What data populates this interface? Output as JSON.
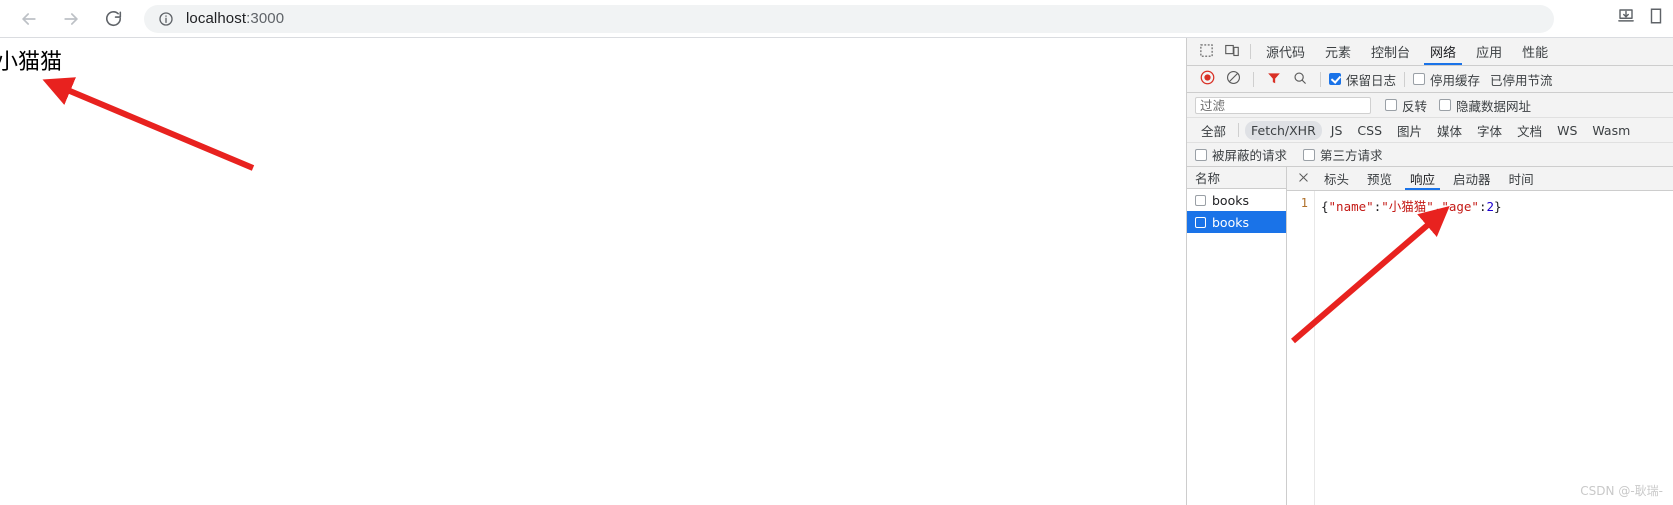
{
  "browser": {
    "back_label": "back-arrow",
    "forward_label": "forward-arrow",
    "reload_label": "reload",
    "info_label": "site-info",
    "url_prefix": "localhost",
    "url_suffix": ":3000",
    "download_label": "downloads",
    "profile_label": "profile"
  },
  "page": {
    "heading": "小猫猫"
  },
  "devtools": {
    "inspect_icon": "inspect-element-icon",
    "device_icon": "device-toolbar-icon",
    "tabs": [
      {
        "label": "源代码",
        "active": false
      },
      {
        "label": "元素",
        "active": false
      },
      {
        "label": "控制台",
        "active": false
      },
      {
        "label": "网络",
        "active": true
      },
      {
        "label": "应用",
        "active": false
      },
      {
        "label": "性能",
        "active": false
      }
    ],
    "actionbar": {
      "record_icon": "record-stop-icon",
      "clear_icon": "clear-icon",
      "filter_icon": "filter-icon",
      "search_icon": "search-icon",
      "preserve_log": {
        "label": "保留日志",
        "checked": true
      },
      "disable_cache": {
        "label": "停用缓存",
        "checked": false
      },
      "throttling": "已停用节流"
    },
    "filterbar": {
      "placeholder": "过滤",
      "value": "",
      "invert": {
        "label": "反转",
        "checked": false
      },
      "hide_data_urls": {
        "label": "隐藏数据网址",
        "checked": false
      }
    },
    "types": [
      {
        "label": "全部",
        "selected": false
      },
      {
        "label": "Fetch/XHR",
        "selected": true
      },
      {
        "label": "JS",
        "selected": false
      },
      {
        "label": "CSS",
        "selected": false
      },
      {
        "label": "图片",
        "selected": false
      },
      {
        "label": "媒体",
        "selected": false
      },
      {
        "label": "字体",
        "selected": false
      },
      {
        "label": "文档",
        "selected": false
      },
      {
        "label": "WS",
        "selected": false
      },
      {
        "label": "Wasm",
        "selected": false
      }
    ],
    "extra_filters": [
      {
        "label": "被屏蔽的请求",
        "checked": false
      },
      {
        "label": "第三方请求",
        "checked": false
      }
    ],
    "request_list": {
      "column_header": "名称",
      "rows": [
        {
          "name": "books",
          "selected": false,
          "checked": false
        },
        {
          "name": "books",
          "selected": true,
          "checked": false
        }
      ]
    },
    "detail": {
      "close_icon": "close-icon",
      "tabs": [
        {
          "label": "标头",
          "active": false
        },
        {
          "label": "预览",
          "active": false
        },
        {
          "label": "响应",
          "active": true
        },
        {
          "label": "启动器",
          "active": false
        },
        {
          "label": "时间",
          "active": false
        }
      ],
      "line_number": "1",
      "response": {
        "brace_open": "{",
        "key_name": "\"name\"",
        "colon1": ":",
        "value_name": "\"小猫猫\"",
        "comma": ",",
        "key_age": "\"age\"",
        "colon2": ":",
        "value_age": "2",
        "brace_close": "}"
      }
    }
  },
  "watermark": "CSDN @-耿瑞-",
  "colors": {
    "accent": "#1a73e8",
    "record_red": "#d93025",
    "string_red": "#c41a16",
    "number_blue": "#1c00cf",
    "arrow_red": "#e8221f"
  }
}
